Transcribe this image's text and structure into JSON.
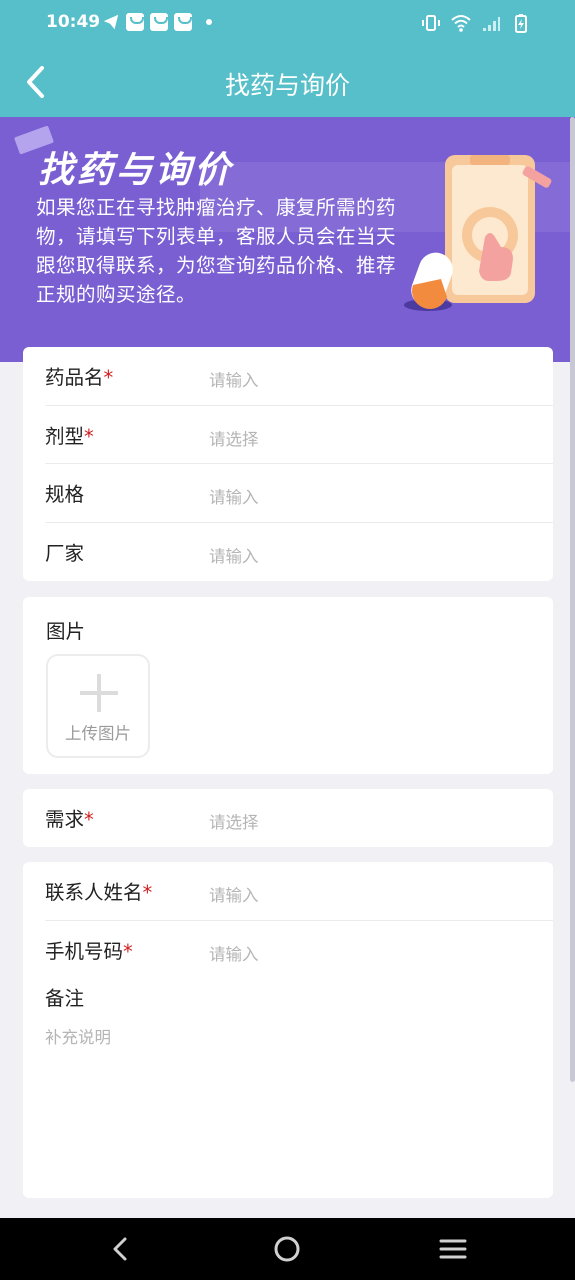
{
  "status_bar": {
    "time": "10:49"
  },
  "nav": {
    "title": "找药与询价"
  },
  "banner": {
    "title": "找药与询价",
    "description": "如果您正在寻找肿瘤治疗、康复所需的药物，请填写下列表单，客服人员会在当天跟您取得联系，为您查询药品价格、推荐正规的购买途径。"
  },
  "drug_form": {
    "drug_name": {
      "label": "药品名",
      "required": "*",
      "placeholder": "请输入"
    },
    "dosage_form": {
      "label": "剂型",
      "required": "*",
      "placeholder": "请选择"
    },
    "spec": {
      "label": "规格",
      "placeholder": "请输入"
    },
    "manufacturer": {
      "label": "厂家",
      "placeholder": "请输入"
    }
  },
  "image_section": {
    "title": "图片",
    "upload_label": "上传图片"
  },
  "demand": {
    "label": "需求",
    "required": "*",
    "placeholder": "请选择"
  },
  "contact": {
    "name": {
      "label": "联系人姓名",
      "required": "*",
      "placeholder": "请输入"
    },
    "phone": {
      "label": "手机号码",
      "required": "*",
      "placeholder": "请输入"
    },
    "remark": {
      "label": "备注",
      "placeholder": "补充说明"
    }
  },
  "colors": {
    "header": "#57bfc9",
    "banner": "#7a5fd3",
    "required": "#d01e1e"
  }
}
